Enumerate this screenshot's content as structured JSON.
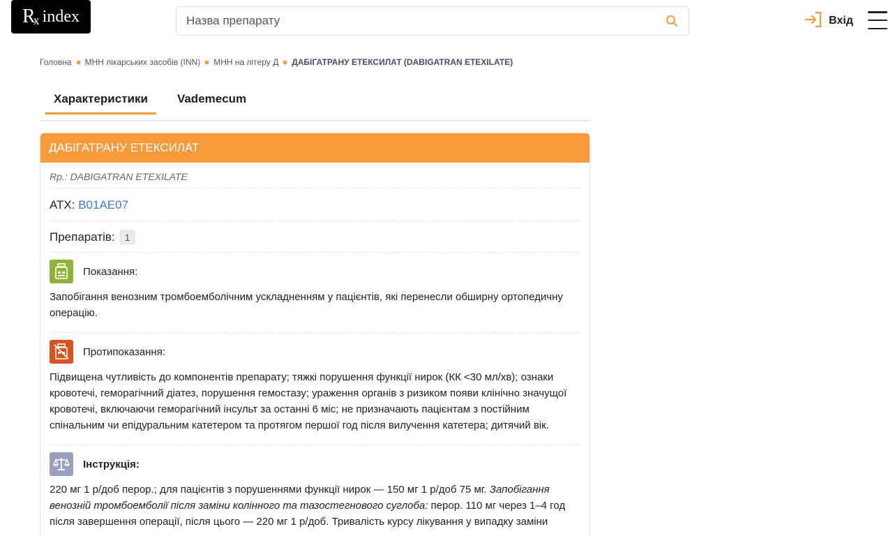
{
  "header": {
    "logo_rx": "R",
    "logo_index": "index",
    "search_placeholder": "Назва препарату",
    "login_label": "Вхід"
  },
  "breadcrumb": {
    "items": [
      "Головна",
      "МНН лікарських засобів (INN)",
      "МНН на літеру Д"
    ],
    "current": "ДАБІГАТРАНУ ЕТЕКСИЛАТ (DABIGATRAN ETEXILATE)"
  },
  "tabs": [
    {
      "label": "Характеристики",
      "active": true
    },
    {
      "label": "Vademecum",
      "active": false
    }
  ],
  "card": {
    "title": "ДАБІГАТРАНУ ЕТЕКСИЛАТ",
    "latin": "Rp.: DABIGATRAN ETEXILATE",
    "atc_label": "АТХ:",
    "atc_code": "B01AE07",
    "count_label": "Препаратів:",
    "count_value": "1",
    "indications": {
      "title": "Показання:",
      "text": "Запобігання венозним тромбоемболічним ускладненням у пацієнтів, які перенесли обширну ортопедичну операцію."
    },
    "contraindications": {
      "title": "Протипоказання:",
      "text": "Підвищена чутливість до компонентів препарату; тяжкі порушення функції нирок (КК <30 мл/хв); ознаки кровотечі, геморагічний діатез, порушення гемостазу; ураження органів з ризиком появи клінічно значущої кровотечі, включаючи геморагічний інсульт за останні 6 міс; не призначають пацієнтам з постійним спінальним чи епідуральним катетером та протягом першої год після вилучення катетера; дитячий вік."
    },
    "instructions": {
      "title": "Інструкція:",
      "text_1": "220 мг 1 р/доб перор.; для пацієнтів з порушеннями функції нирок — 150 мг 1 р/доб 75 мг. ",
      "text_italic": "Запобігання венозній тромбоемболії після заміни колінного та тазостегнового суглоба:",
      "text_2": " перор. 110 мг через 1–4 год після завершення операції, після цього — 220 мг 1 р/доб. Тривалість курсу лікування у випадку заміни"
    }
  },
  "colors": {
    "accent": "#f89a3a",
    "link": "#3a7cc8",
    "indications_icon": "#8fb339",
    "contraindications_icon": "#d9531e",
    "instructions_icon": "#9a9fbd"
  }
}
